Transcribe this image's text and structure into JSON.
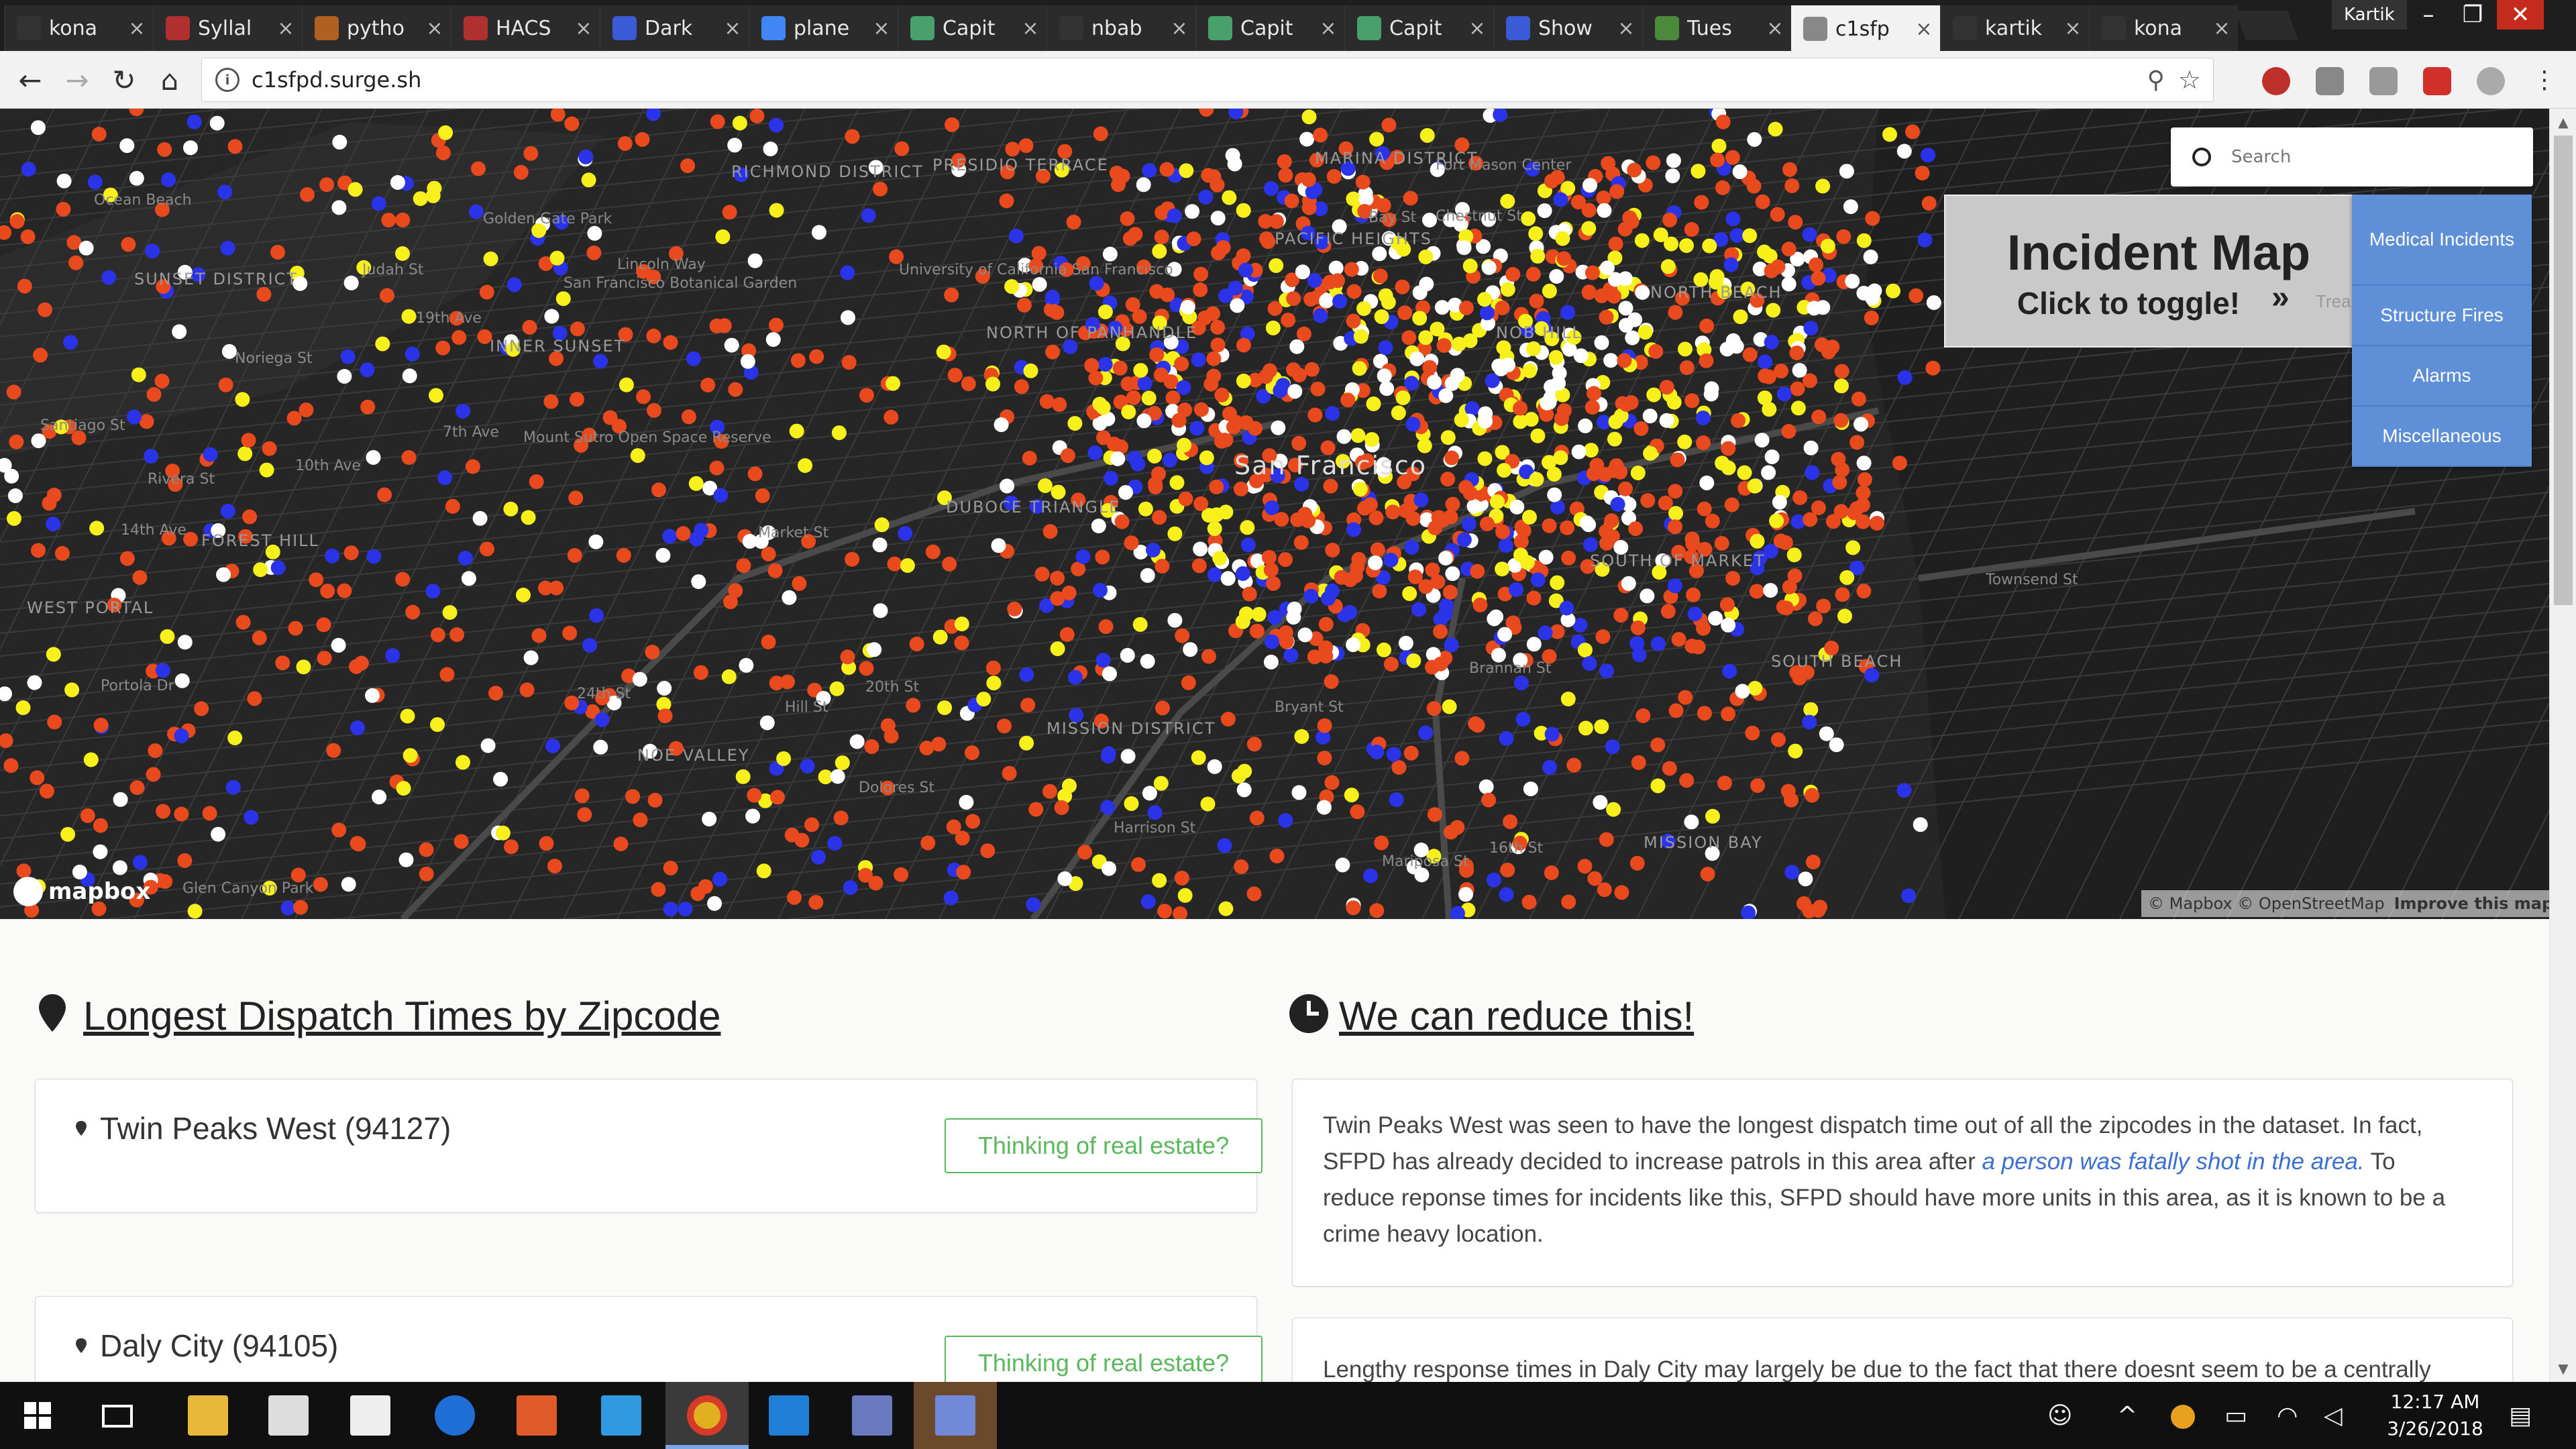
{
  "browser": {
    "tabs": [
      {
        "title": "kona",
        "favicon_color": "#333333",
        "active": false
      },
      {
        "title": "Syllal",
        "favicon_color": "#b03030",
        "active": false
      },
      {
        "title": "pytho",
        "favicon_color": "#b06020",
        "active": false
      },
      {
        "title": "HACS",
        "favicon_color": "#b03030",
        "active": false
      },
      {
        "title": "Dark",
        "favicon_color": "#3b5bd6",
        "active": false
      },
      {
        "title": "plane",
        "favicon_color": "#4285f4",
        "active": false
      },
      {
        "title": "Capit",
        "favicon_color": "#4aa06a",
        "active": false
      },
      {
        "title": "nbab",
        "favicon_color": "#333333",
        "active": false
      },
      {
        "title": "Capit",
        "favicon_color": "#4aa06a",
        "active": false
      },
      {
        "title": "Capit",
        "favicon_color": "#4aa06a",
        "active": false
      },
      {
        "title": "Show",
        "favicon_color": "#3b5bd6",
        "active": false
      },
      {
        "title": "Tues",
        "favicon_color": "#4a8a3a",
        "active": false
      },
      {
        "title": "c1sfp",
        "favicon_color": "#888888",
        "active": true
      },
      {
        "title": "kartik",
        "favicon_color": "#333333",
        "active": false
      },
      {
        "title": "kona",
        "favicon_color": "#333333",
        "active": false
      }
    ],
    "tab_close_glyph": "×",
    "profile_name": "Kartik",
    "url": "c1sfpd.surge.sh"
  },
  "map": {
    "search_placeholder": "Search",
    "toggle_title": "Incident Map",
    "toggle_subtitle": "Click to toggle!",
    "toggle_faded": "Trea",
    "categories": [
      "Medical Incidents",
      "Structure Fires",
      "Alarms",
      "Miscellaneous"
    ],
    "mapbox_logo": "mapbox",
    "attribution": "© Mapbox © OpenStreetMap",
    "improve": "Improve this map",
    "dot_colors": {
      "medical": "#e8491d",
      "fire": "#f7f01a",
      "alarm": "#2a33e8",
      "misc": "#ffffff"
    },
    "neighborhood_labels": [
      "RICHMOND DISTRICT",
      "PRESIDIO TERRACE",
      "MARINA DISTRICT",
      "SUNSET DISTRICT",
      "INNER SUNSET",
      "FOREST HILL",
      "WEST PORTAL",
      "NOE VALLEY",
      "MISSION DISTRICT",
      "SOUTH OF MARKET",
      "SOUTH BEACH",
      "MISSION BAY",
      "NORTH BEACH",
      "NOB HILL",
      "PACIFIC HEIGHTS",
      "DUBOCE TRIANGLE",
      "NORTH OF PANHANDLE",
      "San Francisco"
    ],
    "street_labels": [
      "Ocean Beach",
      "Golden Gate Park",
      "San Francisco Botanical Garden",
      "University of California San Francisco",
      "Mount Sutro Open Space Reserve",
      "Glen Canyon Park",
      "Fort Mason Center",
      "Brannan St",
      "Market St",
      "Portola Dr",
      "Judah St",
      "Noriega St",
      "Rivera St",
      "Santiago St",
      "14th Ave",
      "19th Ave",
      "7th Ave",
      "Hill St",
      "24th St",
      "20th St",
      "Mariposa St",
      "16th St",
      "Harrison St",
      "Bryant St",
      "Bay St",
      "Chestnut St",
      "Lincoln Way",
      "10th Ave",
      "Dolores St",
      "Townsend St"
    ]
  },
  "content": {
    "left_title": "Longest Dispatch Times by Zipcode",
    "right_title": "We can reduce this!",
    "zips": [
      {
        "name": "Twin Peaks West (94127)",
        "button": "Thinking of real estate?"
      },
      {
        "name": "Daly City (94105)",
        "button": "Thinking of real estate?"
      }
    ],
    "para1_before": "Twin Peaks West was seen to have the longest dispatch time out of all the zipcodes in the dataset. In fact, SFPD has already decided to increase patrols in this area after ",
    "para1_link": "a person was fatally shot in the area.",
    "para1_after": " To reduce reponse times for incidents like this, SFPD should have more units in this area, as it is known to be a crime heavy location.",
    "para2": "Lengthy response times in Daly City may largely be due to the fact that there doesnt seem to be a centrally"
  },
  "taskbar": {
    "time": "12:17 AM",
    "date": "3/26/2018"
  }
}
